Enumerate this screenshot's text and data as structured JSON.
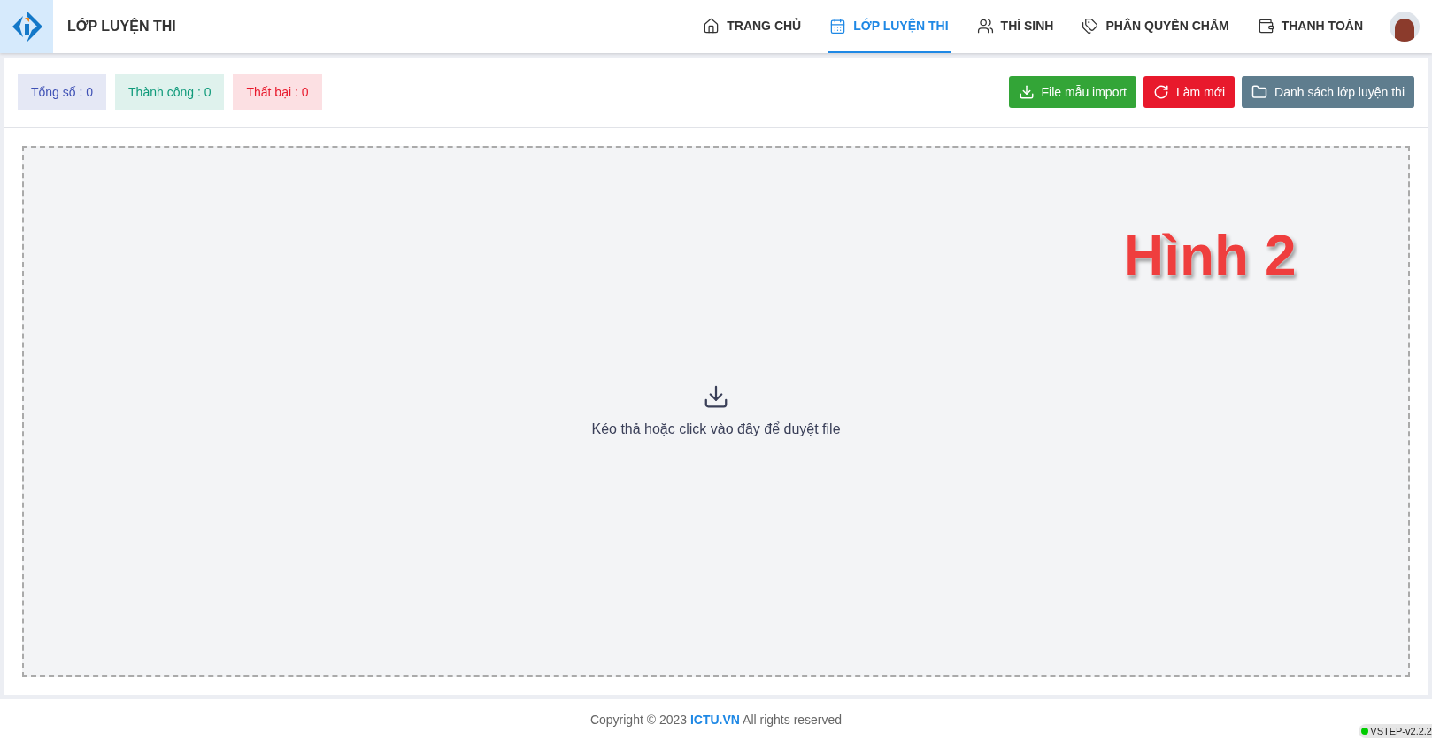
{
  "header": {
    "title": "LỚP LUYỆN THI",
    "nav": [
      {
        "label": "TRANG CHỦ",
        "kind": "home",
        "selected": false
      },
      {
        "label": "LỚP LUYỆN THI",
        "kind": "calendar",
        "selected": true
      },
      {
        "label": "THÍ SINH",
        "kind": "users",
        "selected": false
      },
      {
        "label": "PHÂN QUYỀN CHẤM",
        "kind": "tags",
        "selected": false
      },
      {
        "label": "THANH TOÁN",
        "kind": "wallet",
        "selected": false
      }
    ]
  },
  "stats": [
    {
      "label": "Tổng số : 0",
      "color": "#3f51b5"
    },
    {
      "label": "Thành công : 0",
      "color": "#0f9a7a"
    },
    {
      "label": "Thất bại : 0",
      "color": "#e8192c"
    }
  ],
  "actions": [
    {
      "label": "File mẫu import",
      "kind": "download",
      "color": "#33a537"
    },
    {
      "label": "Làm mới",
      "kind": "refresh",
      "color": "#e8192c"
    },
    {
      "label": "Danh sách lớp luyện thi",
      "kind": "folder",
      "color": "#5f7d8e"
    }
  ],
  "dropzone": {
    "text": "Kéo thả hoặc click vào đây để duyệt file"
  },
  "annotation": "Hình 2",
  "footer": {
    "prefix": "Copyright © 2023",
    "link": "ICTU.VN",
    "suffix": "All rights reserved"
  },
  "version": "VSTEP-v2.2.2"
}
